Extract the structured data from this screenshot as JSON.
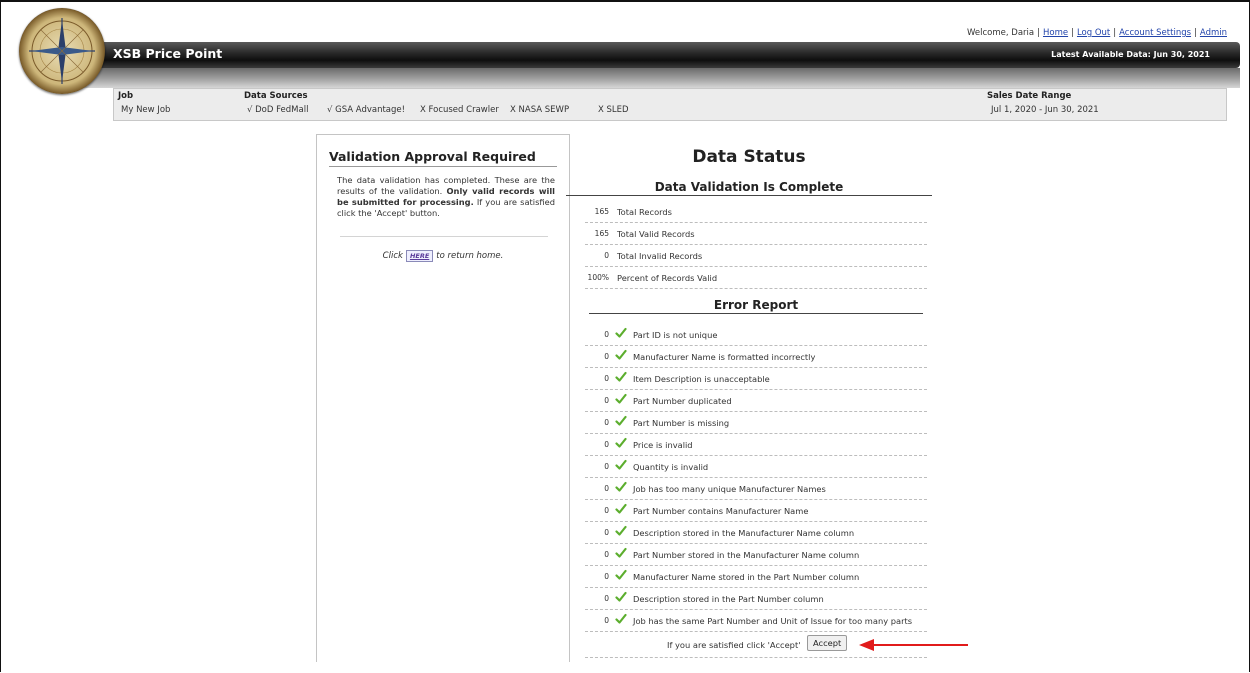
{
  "header": {
    "welcome": "Welcome, Daria",
    "links": [
      "Home",
      "Log Out",
      "Account Settings",
      "Admin"
    ],
    "brand": "XSB Price Point",
    "latest_data": "Latest Available Data: Jun 30, 2021"
  },
  "infobar": {
    "job_label": "Job",
    "job_value": "My New Job",
    "sources_label": "Data Sources",
    "sources": [
      {
        "mark": "√",
        "name": "DoD FedMall"
      },
      {
        "mark": "√",
        "name": "GSA Advantage!"
      },
      {
        "mark": "X",
        "name": "Focused Crawler"
      },
      {
        "mark": "X",
        "name": "NASA SEWP"
      },
      {
        "mark": "X",
        "name": "SLED"
      }
    ],
    "sales_label": "Sales Date Range",
    "sales_value": "Jul 1, 2020 - Jun 30, 2021"
  },
  "approval": {
    "title": "Validation Approval Required",
    "text_1": "The data validation has completed. These are the results of the validation.",
    "text_bold": "Only valid records will be submitted for processing.",
    "text_2": "If you are satisfied click the 'Accept' button.",
    "click_prefix": "Click",
    "here_label": "HERE",
    "click_suffix": "to return home."
  },
  "status": {
    "title": "Data Status",
    "validation_heading": "Data Validation Is Complete",
    "summary": [
      {
        "value": "165",
        "label": "Total Records"
      },
      {
        "value": "165",
        "label": "Total Valid Records"
      },
      {
        "value": "0",
        "label": "Total Invalid Records"
      },
      {
        "value": "100%",
        "label": "Percent of Records Valid"
      }
    ],
    "error_heading": "Error Report",
    "errors": [
      {
        "value": "0",
        "label": "Part ID is not unique"
      },
      {
        "value": "0",
        "label": "Manufacturer Name is formatted incorrectly"
      },
      {
        "value": "0",
        "label": "Item Description is unacceptable"
      },
      {
        "value": "0",
        "label": "Part Number duplicated"
      },
      {
        "value": "0",
        "label": "Part Number is missing"
      },
      {
        "value": "0",
        "label": "Price is invalid"
      },
      {
        "value": "0",
        "label": "Quantity is invalid"
      },
      {
        "value": "0",
        "label": "Job has too many unique Manufacturer Names"
      },
      {
        "value": "0",
        "label": "Part Number contains Manufacturer Name"
      },
      {
        "value": "0",
        "label": "Description stored in the Manufacturer Name column"
      },
      {
        "value": "0",
        "label": "Part Number stored in the Manufacturer Name column"
      },
      {
        "value": "0",
        "label": "Manufacturer Name stored in the Part Number column"
      },
      {
        "value": "0",
        "label": "Description stored in the Part Number column"
      },
      {
        "value": "0",
        "label": "Job has the same Part Number and Unit of Issue for too many parts"
      }
    ],
    "accept_prompt": "If you are satisfied click 'Accept'",
    "accept_label": "Accept"
  },
  "colors": {
    "check_green": "#5cae2e",
    "arrow_red": "#e11b1b",
    "link_blue": "#2244aa"
  },
  "icons": {
    "check": "check-icon",
    "arrow": "arrow-left-icon",
    "logo": "compass-logo"
  }
}
